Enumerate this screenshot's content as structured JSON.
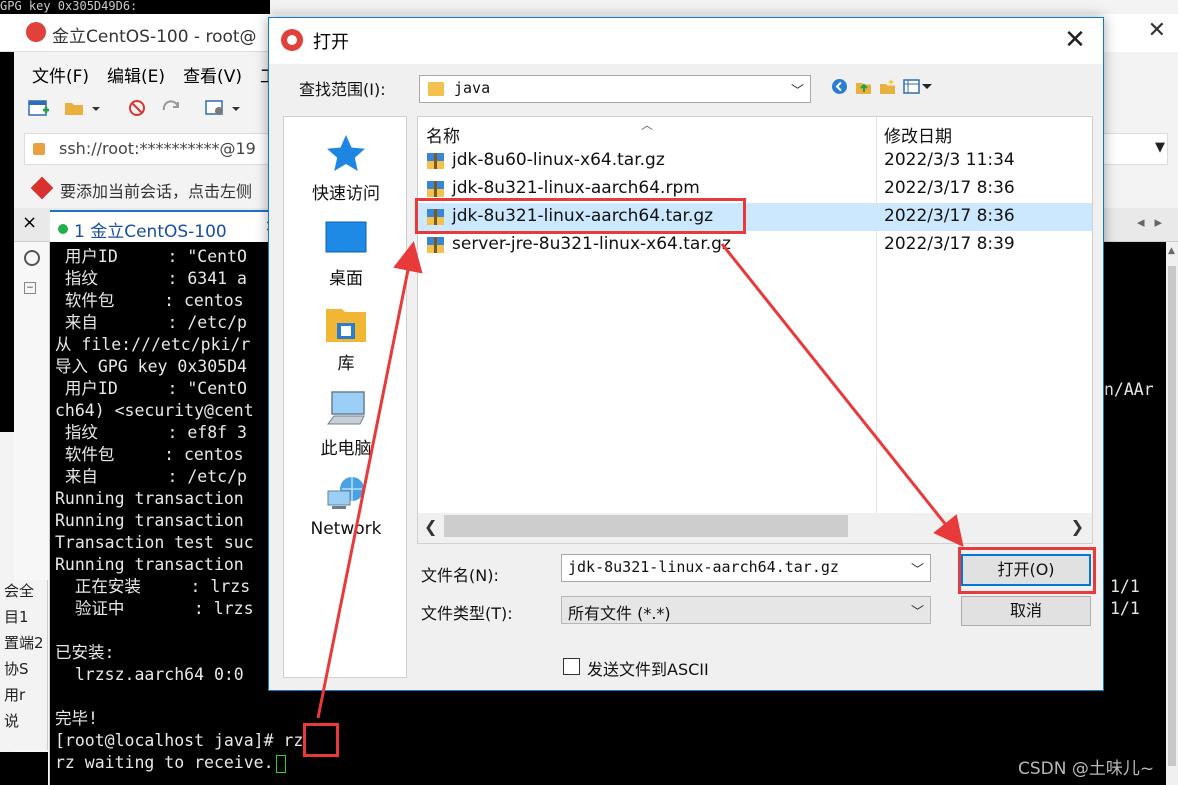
{
  "background_window": {
    "title": "金立CentOS-100 - root@",
    "top_strip_text": "GPG key 0x305D49D6:",
    "menu": [
      "文件(F)",
      "编辑(E)",
      "查看(V)",
      "工"
    ],
    "address": "ssh://root:**********@19",
    "hint": "要添加当前会话，点击左侧",
    "tab_label": "1 金立CentOS-100",
    "tab_close": "×",
    "tab_bar_close": "×",
    "left_chars": [
      "会全",
      "目1",
      "置端2",
      "协S",
      "用r",
      "说"
    ]
  },
  "terminal": {
    "lines": [
      " 用户ID     : \"CentO",
      " 指纹       : 6341 a",
      " 软件包     : centos",
      " 来自       : /etc/p",
      "从 file:///etc/pki/r",
      "导入 GPG key 0x305D4",
      " 用户ID     : \"CentO",
      "ch64) <security@cent",
      " 指纹       : ef8f 3",
      " 软件包     : centos",
      " 来自       : /etc/p",
      "Running transaction ",
      "Running transaction ",
      "Transaction test suc",
      "Running transaction ",
      "  正在安装     : lrzs",
      "  验证中       : lrzs",
      "",
      "已安装:",
      "  lrzsz.aarch64 0:0",
      "",
      "完毕!",
      "[root@localhost java]# rz",
      "rz waiting to receive."
    ],
    "right_fragment": "n/AAr",
    "progress_1": "1/1",
    "progress_2": "1/1"
  },
  "dialog": {
    "title": "打开",
    "look_in_label": "查找范围(I):",
    "look_in_value": "java",
    "places": [
      {
        "label": "快速访问",
        "icon": "quick-access-icon"
      },
      {
        "label": "桌面",
        "icon": "desktop-icon"
      },
      {
        "label": "库",
        "icon": "library-icon"
      },
      {
        "label": "此电脑",
        "icon": "this-pc-icon"
      },
      {
        "label": "Network",
        "icon": "network-icon"
      }
    ],
    "columns": {
      "name": "名称",
      "date": "修改日期"
    },
    "files": [
      {
        "name": "jdk-8u60-linux-x64.tar.gz",
        "date": "2022/3/3 11:34"
      },
      {
        "name": "jdk-8u321-linux-aarch64.rpm",
        "date": "2022/3/17 8:36"
      },
      {
        "name": "jdk-8u321-linux-aarch64.tar.gz",
        "date": "2022/3/17 8:36"
      },
      {
        "name": "server-jre-8u321-linux-x64.tar.gz",
        "date": "2022/3/17 8:39"
      }
    ],
    "selected_index": 2,
    "file_name_label": "文件名(N):",
    "file_name_value": "jdk-8u321-linux-aarch64.tar.gz",
    "file_type_label": "文件类型(T):",
    "file_type_value": "所有文件 (*.*)",
    "open_button": "打开(O)",
    "cancel_button": "取消",
    "ascii_checkbox_label": "发送文件到ASCII",
    "ascii_checked": false
  },
  "watermark": "CSDN @土味儿~",
  "colors": {
    "accent": "#0078d7",
    "selection": "#cce8ff",
    "annotation": "#e83a3a",
    "terminal_bg": "#000000",
    "cursor": "#27d040"
  }
}
